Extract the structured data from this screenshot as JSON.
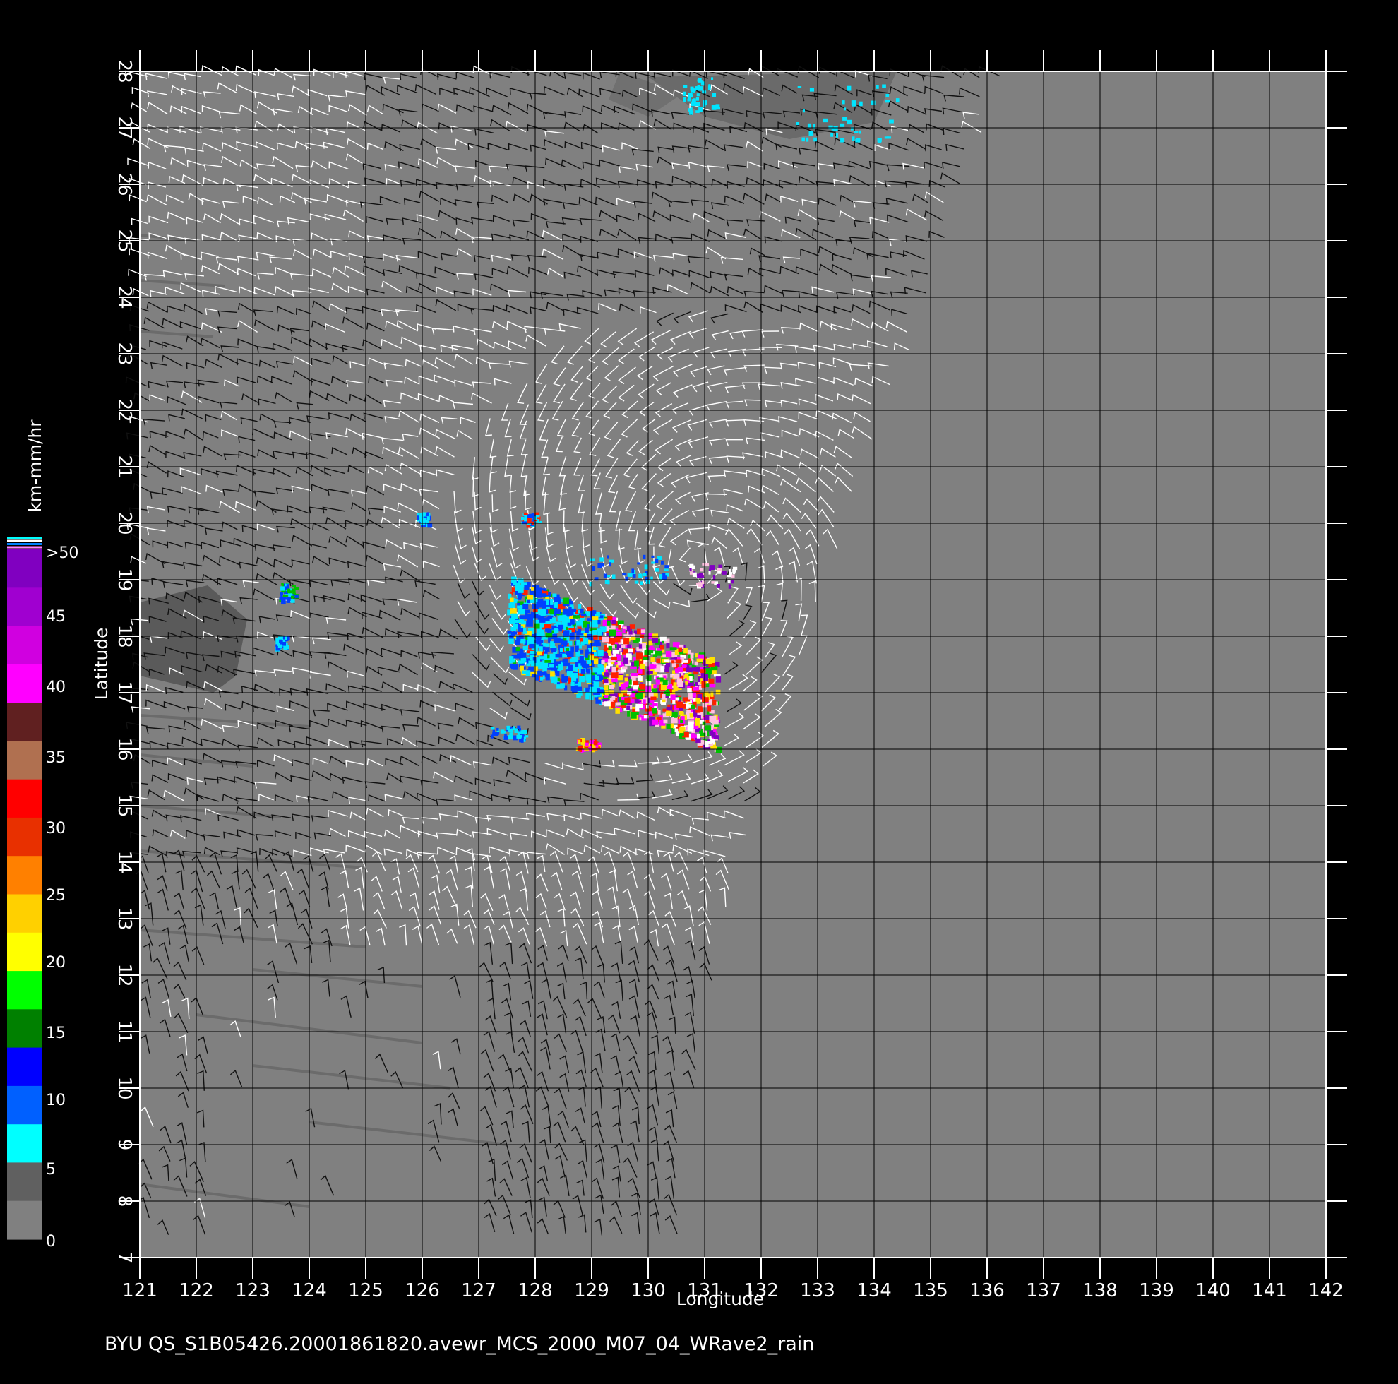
{
  "footer_text": "BYU  QS_S1B05426.20001861820.avewr_MCS_2000_M07_04_WRave2_rain",
  "colorbar": {
    "unit_label": "km-mm/hr",
    "tick_labels": [
      ">50",
      "45",
      "40",
      "35",
      "30",
      "25",
      "20",
      "15",
      "10",
      "5",
      "0"
    ]
  },
  "colors": {
    "background": "#000000",
    "map_fill": "#808080",
    "grid_line": "#000000",
    "frame": "#ffffff",
    "wind_white": "#ffffff",
    "wind_black": "#111111",
    "rain_cyan": "#00e5ff",
    "rain_blue": "#0040ff",
    "rain_green": "#00c000",
    "rain_yellow": "#ffe000",
    "rain_red": "#ff2000",
    "rain_magenta": "#ff00ff",
    "rain_purple": "#8000c0",
    "rain_pink": "#ffc0e0"
  },
  "chart_data": {
    "type": "map",
    "xlabel": "Longitude",
    "ylabel": "Latitude",
    "x_ticks": [
      "121",
      "122",
      "123",
      "124",
      "125",
      "126",
      "127",
      "128",
      "129",
      "130",
      "131",
      "132",
      "133",
      "134",
      "135",
      "136",
      "137",
      "138",
      "139",
      "140",
      "141",
      "142"
    ],
    "y_ticks": [
      "7",
      "8",
      "9",
      "10",
      "11",
      "12",
      "13",
      "14",
      "15",
      "16",
      "17",
      "18",
      "19",
      "20",
      "21",
      "22",
      "23",
      "24",
      "25",
      "26",
      "27",
      "28"
    ],
    "xlim": [
      121,
      142
    ],
    "ylim": [
      7,
      28
    ],
    "grid": true,
    "colorbar_range": [
      0,
      50
    ],
    "colorbar_placement": "left",
    "swath_right_edge": [
      [
        136.3,
        28
      ],
      [
        135,
        24
      ],
      [
        133.8,
        20.8
      ],
      [
        132.2,
        16
      ],
      [
        131.8,
        14.5
      ],
      [
        131,
        11
      ],
      [
        130.5,
        7
      ]
    ],
    "cyclone_center": [
      130.9,
      19.3
    ],
    "rain_band": {
      "lon": [
        127.5,
        131.2
      ],
      "lat": [
        15.9,
        18.6
      ],
      "max_rate": ">50"
    }
  }
}
